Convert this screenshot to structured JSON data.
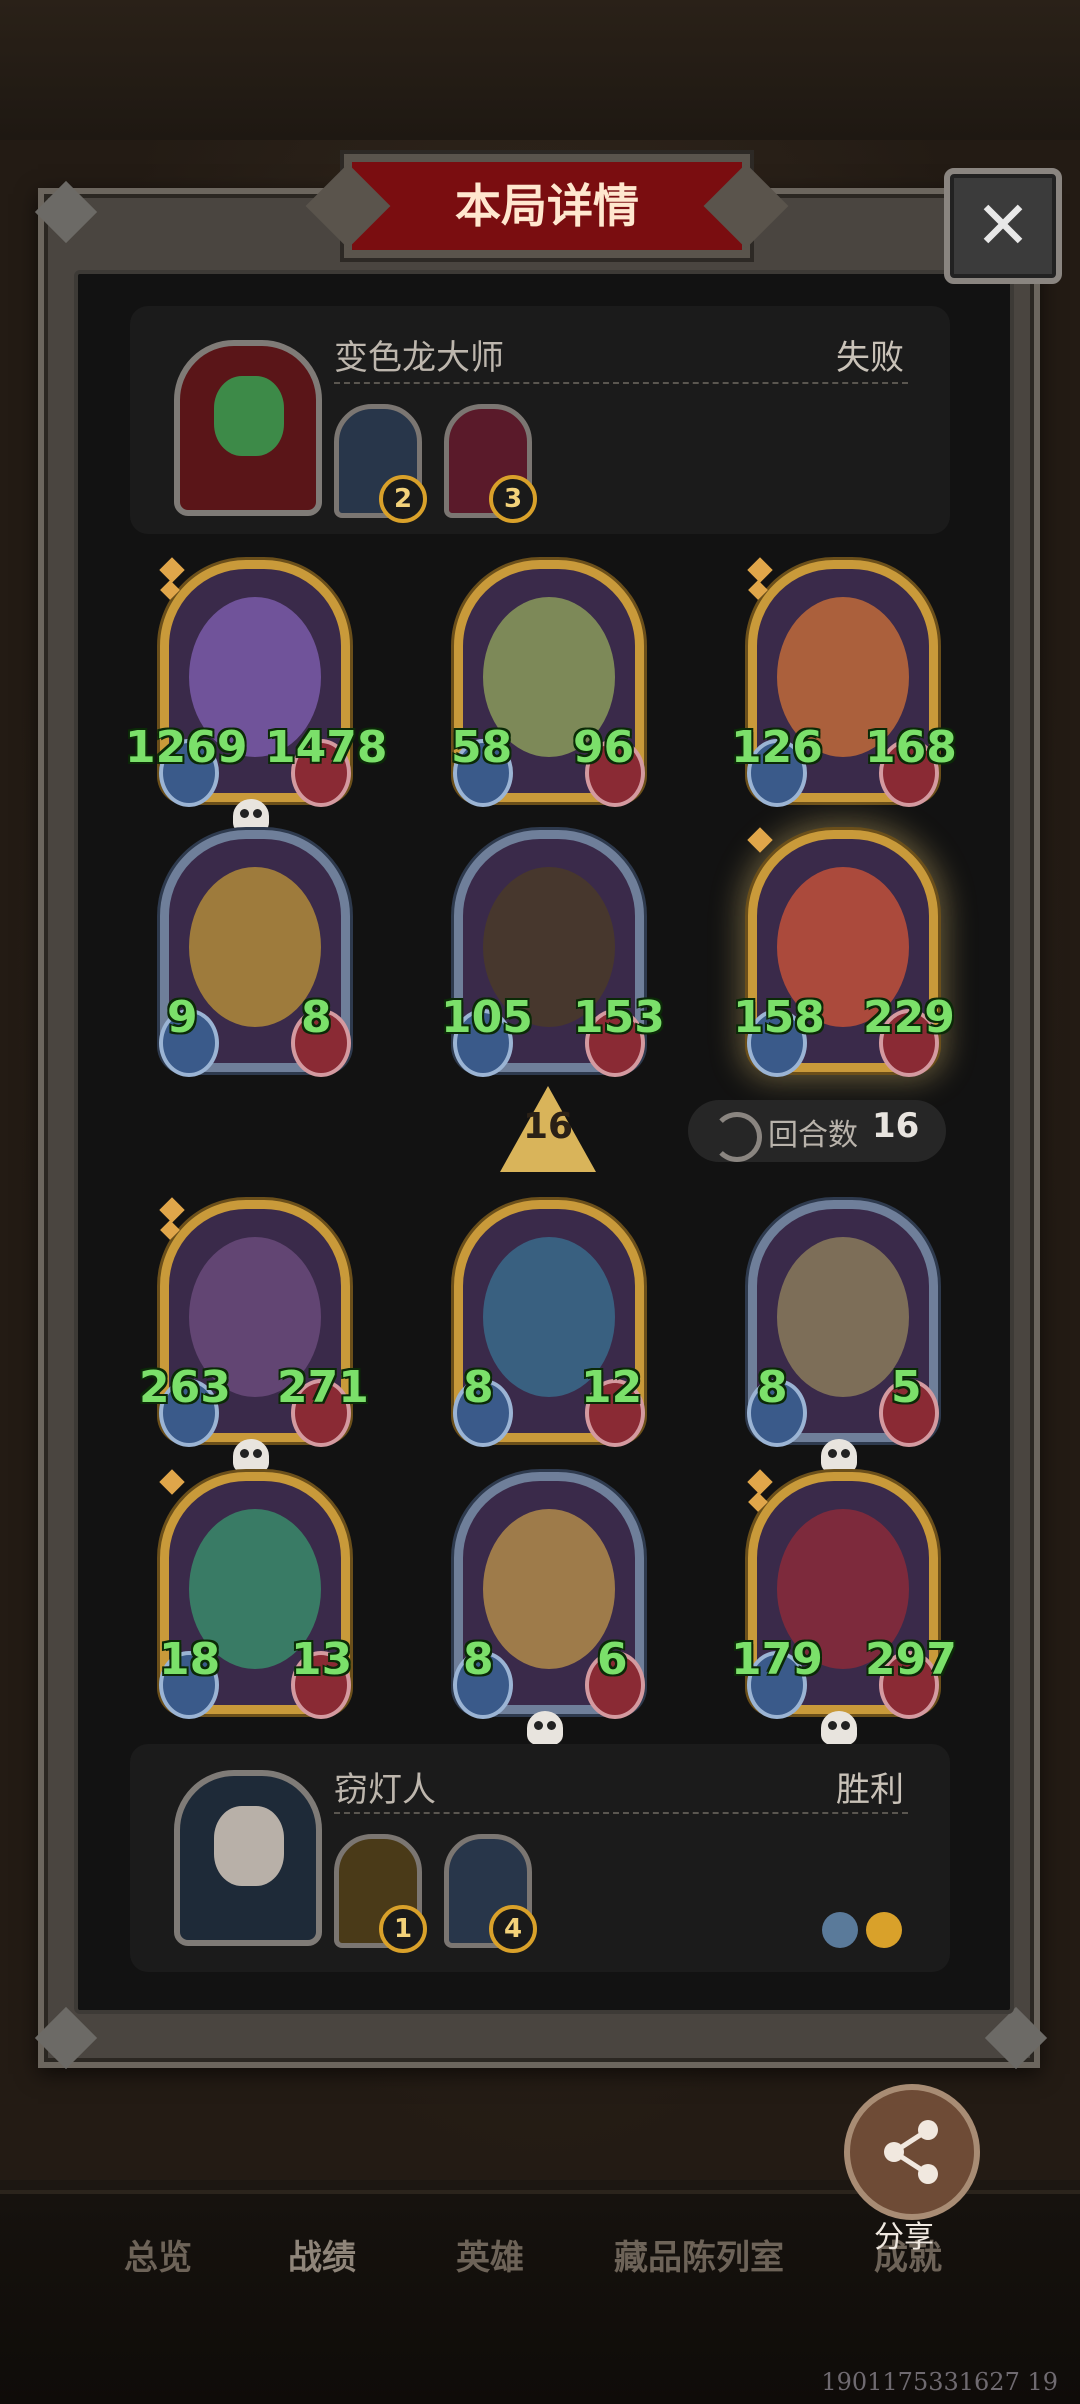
{
  "title": "本局详情",
  "close_symbol": "✕",
  "opponent": {
    "name": "变色龙大师",
    "result": "失败",
    "items": [
      {
        "badge": "2"
      },
      {
        "badge": "3"
      }
    ]
  },
  "player": {
    "name": "窃灯人",
    "result": "胜利",
    "items": [
      {
        "badge": "1"
      },
      {
        "badge": "4"
      }
    ]
  },
  "opponent_units": [
    {
      "attack": "1269",
      "health": "1478"
    },
    {
      "attack": "58",
      "health": "96"
    },
    {
      "attack": "126",
      "health": "168"
    },
    {
      "attack": "9",
      "health": "8"
    },
    {
      "attack": "105",
      "health": "153"
    },
    {
      "attack": "158",
      "health": "229"
    }
  ],
  "player_units": [
    {
      "attack": "263",
      "health": "271"
    },
    {
      "attack": "8",
      "health": "12"
    },
    {
      "attack": "8",
      "health": "5"
    },
    {
      "attack": "18",
      "health": "13"
    },
    {
      "attack": "8",
      "health": "6"
    },
    {
      "attack": "179",
      "health": "297"
    }
  ],
  "turn": {
    "marker": "16",
    "label": "回合数",
    "value": "16"
  },
  "share": {
    "label": "分享"
  },
  "nav": [
    "总览",
    "战绩",
    "英雄",
    "藏品陈列室",
    "成就"
  ],
  "footer_id": "1901175331627 19",
  "colors": {
    "stat_green": "#7be06a",
    "title_red": "#7a0d10",
    "gold_frame": "#c99a3a"
  }
}
